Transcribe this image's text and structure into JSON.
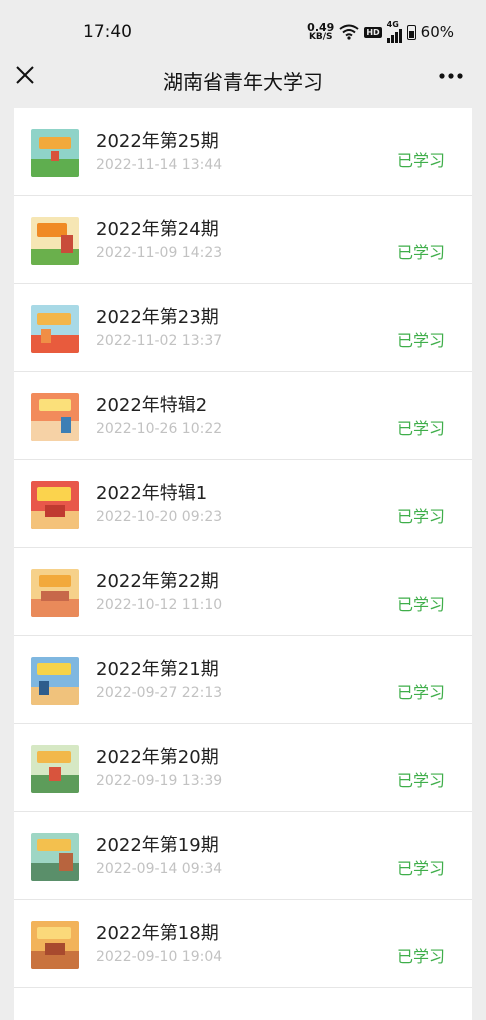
{
  "statusbar": {
    "time": "17:40",
    "net_speed_value": "0.49",
    "net_speed_unit": "KB/S",
    "hd_label": "HD",
    "network_type": "4G",
    "battery": "60%",
    "icons": [
      "wifi-icon",
      "hd-icon",
      "signal-icon",
      "battery-icon"
    ]
  },
  "navbar": {
    "title": "湖南省青年大学习",
    "close_icon": "close-icon",
    "more_icon": "more-icon"
  },
  "colors": {
    "background": "#ededed",
    "card": "#ffffff",
    "status_green": "#3fae4a",
    "date_gray": "#c2c2c2"
  },
  "items": [
    {
      "title": "2022年第25期",
      "date": "2022-11-14 13:44",
      "status": "已学习",
      "thumb": "episode-thumbnail"
    },
    {
      "title": "2022年第24期",
      "date": "2022-11-09 14:23",
      "status": "已学习",
      "thumb": "episode-thumbnail"
    },
    {
      "title": "2022年第23期",
      "date": "2022-11-02 13:37",
      "status": "已学习",
      "thumb": "episode-thumbnail"
    },
    {
      "title": "2022年特辑2",
      "date": "2022-10-26 10:22",
      "status": "已学习",
      "thumb": "episode-thumbnail"
    },
    {
      "title": "2022年特辑1",
      "date": "2022-10-20 09:23",
      "status": "已学习",
      "thumb": "episode-thumbnail"
    },
    {
      "title": "2022年第22期",
      "date": "2022-10-12 11:10",
      "status": "已学习",
      "thumb": "episode-thumbnail"
    },
    {
      "title": "2022年第21期",
      "date": "2022-09-27 22:13",
      "status": "已学习",
      "thumb": "episode-thumbnail"
    },
    {
      "title": "2022年第20期",
      "date": "2022-09-19 13:39",
      "status": "已学习",
      "thumb": "episode-thumbnail"
    },
    {
      "title": "2022年第19期",
      "date": "2022-09-14 09:34",
      "status": "已学习",
      "thumb": "episode-thumbnail"
    },
    {
      "title": "2022年第18期",
      "date": "2022-09-10 19:04",
      "status": "已学习",
      "thumb": "episode-thumbnail"
    }
  ]
}
